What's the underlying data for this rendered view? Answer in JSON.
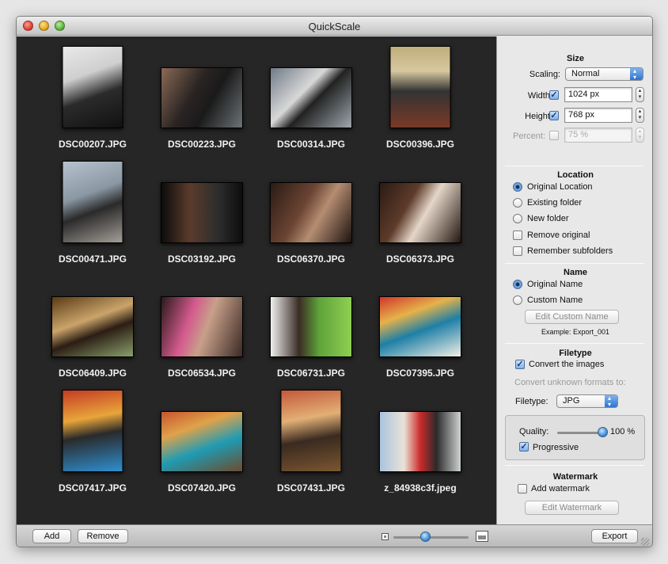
{
  "window": {
    "title": "QuickScale"
  },
  "photos": [
    {
      "name": "DSC00207.JPG",
      "w": 77,
      "h": 104,
      "bg": "linear-gradient(160deg,#e9e9e9 0%,#cfcfcf 35%,#2b2b2b 60%,#111 100%)"
    },
    {
      "name": "DSC00223.JPG",
      "w": 104,
      "h": 77,
      "bg": "linear-gradient(120deg,#8a6a55 0%,#2a2423 40%,#1a1a1a 60%,#6d7377 100%)"
    },
    {
      "name": "DSC00314.JPG",
      "w": 104,
      "h": 77,
      "bg": "linear-gradient(135deg,#6f7a86 0%,#d8d8d8 40%,#222 55%,#9ea7ae 100%)"
    },
    {
      "name": "DSC00396.JPG",
      "w": 77,
      "h": 104,
      "bg": "linear-gradient(180deg,#bfae7a 0%,#d8c8a0 30%,#333 55%,#7a3a28 100%)"
    },
    {
      "name": "DSC00471.JPG",
      "w": 77,
      "h": 104,
      "bg": "linear-gradient(160deg,#b6c3cf 0%,#8b98a4 40%,#2a2a2a 60%,#a49e97 100%)"
    },
    {
      "name": "DSC03192.JPG",
      "w": 104,
      "h": 77,
      "bg": "linear-gradient(90deg,#0c0c0c 0%,#5b3b2b 35%,#2d2d2d 70%,#0d0d0d 100%)"
    },
    {
      "name": "DSC06370.JPG",
      "w": 104,
      "h": 77,
      "bg": "linear-gradient(120deg,#2a1b14 0%,#6b4433 40%,#b58d72 60%,#1e1410 100%)"
    },
    {
      "name": "DSC06373.JPG",
      "w": 104,
      "h": 77,
      "bg": "linear-gradient(120deg,#2a1b14 0%,#5e3b2a 35%,#e4d6c8 55%,#241710 100%)"
    },
    {
      "name": "DSC06409.JPG",
      "w": 104,
      "h": 77,
      "bg": "linear-gradient(160deg,#5a3a16 0%,#caa46a 40%,#2b1d14 60%,#8aa06c 100%)"
    },
    {
      "name": "DSC06534.JPG",
      "w": 104,
      "h": 77,
      "bg": "linear-gradient(110deg,#2a1a1a 0%,#d45a8e 35%,#c8a08a 55%,#3a2a25 100%)"
    },
    {
      "name": "DSC06731.JPG",
      "w": 104,
      "h": 77,
      "bg": "linear-gradient(90deg,#f0f0f0 0%,#3a2c25 35%,#5fa33a 60%,#8fcf52 100%)"
    },
    {
      "name": "DSC07395.JPG",
      "w": 104,
      "h": 77,
      "bg": "linear-gradient(160deg,#d0362a 0%,#e6b24a 30%,#1e7fa6 55%,#f1efe6 100%)"
    },
    {
      "name": "DSC07417.JPG",
      "w": 77,
      "h": 104,
      "bg": "linear-gradient(170deg,#c43b24 0%,#e8a53a 35%,#2a2a2a 55%,#2f8fd0 100%)"
    },
    {
      "name": "DSC07420.JPG",
      "w": 104,
      "h": 77,
      "bg": "linear-gradient(160deg,#c6552e 0%,#e0a24a 30%,#1f9bb3 60%,#6d4b2e 100%)"
    },
    {
      "name": "DSC07431.JPG",
      "w": 77,
      "h": 104,
      "bg": "linear-gradient(170deg,#c4583a 0%,#e2b076 35%,#3a2a20 60%,#7a5630 100%)"
    },
    {
      "name": "z_84938c3f.jpeg",
      "w": 104,
      "h": 77,
      "bg": "linear-gradient(90deg,#a9c4e0 0%,#e9e2d6 30%,#cc2a2a 50%,#2a2a2a 70%,#cfd2d2 100%)"
    }
  ],
  "bottombar": {
    "add_label": "Add",
    "remove_label": "Remove",
    "export_label": "Export"
  },
  "size": {
    "title": "Size",
    "scaling_label": "Scaling:",
    "scaling_value": "Normal",
    "width_label": "Width:",
    "width_value": "1024 px",
    "width_checked": true,
    "height_label": "Height:",
    "height_value": "768 px",
    "height_checked": true,
    "percent_label": "Percent:",
    "percent_value": "75 %",
    "percent_checked": false
  },
  "location": {
    "title": "Location",
    "original_label": "Original Location",
    "existing_label": "Existing folder",
    "new_label": "New folder",
    "selected": "original",
    "remove_original_label": "Remove original",
    "remember_subfolders_label": "Remember subfolders"
  },
  "name": {
    "title": "Name",
    "original_label": "Original Name",
    "custom_label": "Custom Name",
    "selected": "original",
    "edit_button_label": "Edit Custom Name",
    "example_text": "Example: Export_001"
  },
  "filetype": {
    "title": "Filetype",
    "convert_label": "Convert the images",
    "convert_checked": true,
    "unknown_label": "Convert unknown formats to:",
    "filetype_label": "Filetype:",
    "filetype_value": "JPG",
    "quality_label": "Quality:",
    "quality_value": "100 %",
    "quality_fraction": 1.0,
    "progressive_label": "Progressive",
    "progressive_checked": true
  },
  "watermark": {
    "title": "Watermark",
    "add_label": "Add watermark",
    "add_checked": false,
    "edit_button_label": "Edit Watermark"
  }
}
